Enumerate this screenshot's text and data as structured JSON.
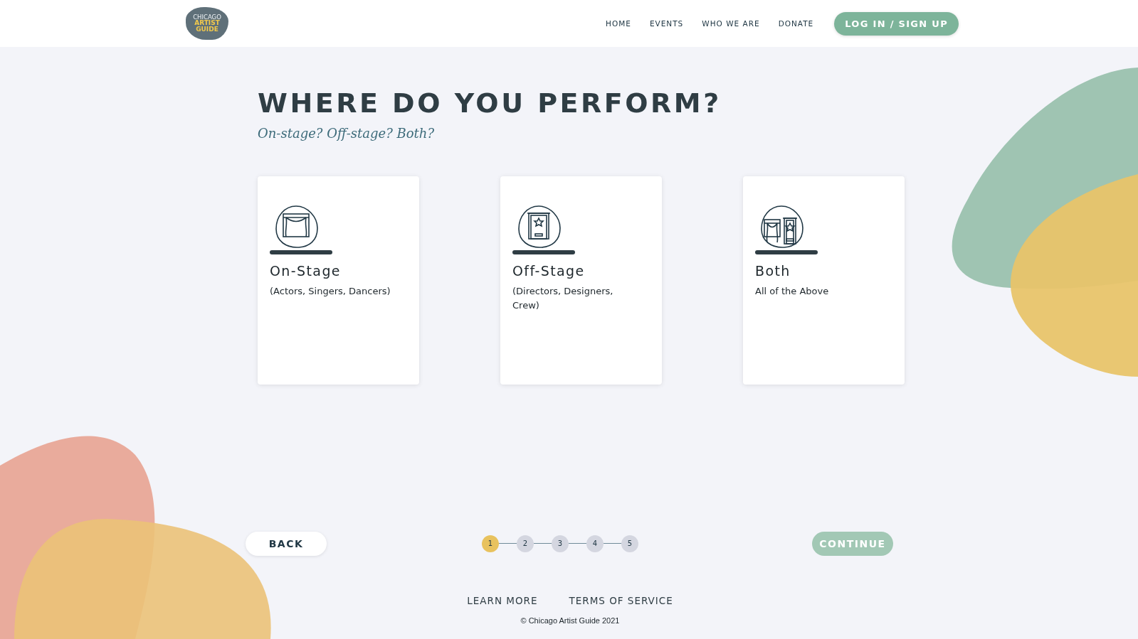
{
  "header": {
    "logo": {
      "line_1": "CHICAGO",
      "line_2": "ARTIST",
      "line_3": "GUIDE"
    },
    "nav": [
      {
        "label": "HOME"
      },
      {
        "label": "EVENTS"
      },
      {
        "label": "WHO WE ARE"
      },
      {
        "label": "DONATE"
      }
    ],
    "login_button": "LOG IN / SIGN UP"
  },
  "heading": "WHERE DO YOU PERFORM?",
  "subheading": "On-stage? Off-stage? Both?",
  "options": [
    {
      "kind": "stage",
      "title": "On-Stage",
      "description": "(Actors, Singers, Dancers)"
    },
    {
      "kind": "door",
      "title": "Off-Stage",
      "description": "(Directors, Designers, Crew)"
    },
    {
      "kind": "both",
      "title": "Both",
      "description": "All of the Above"
    }
  ],
  "back_button": "BACK",
  "steps": [
    {
      "label": "1",
      "selected": true
    },
    {
      "label": "2",
      "selected": false
    },
    {
      "label": "3",
      "selected": false
    },
    {
      "label": "4",
      "selected": false
    },
    {
      "label": "5",
      "selected": false
    }
  ],
  "continue_button": {
    "label": "CONTINUE",
    "disabled": true
  },
  "footer": {
    "links": [
      "LEARN MORE",
      "TERMS OF SERVICE"
    ],
    "copyright": "© Chicago Artist Guide 2021"
  }
}
